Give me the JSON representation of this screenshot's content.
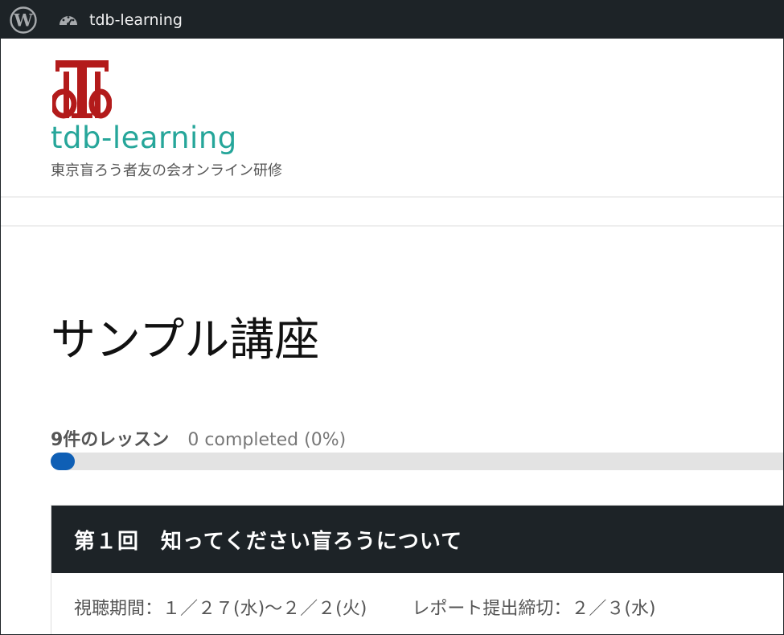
{
  "admin_bar": {
    "site_name": "tdb-learning",
    "icons": [
      "wordpress-logo-icon",
      "dashboard-gauge-icon"
    ],
    "background": "#1d2327"
  },
  "header": {
    "logo_icon": "tdb-monogram-logo",
    "logo_color": "#b31b1b",
    "site_title": "tdb-learning",
    "site_title_color": "#26a69a",
    "tagline": "東京盲ろう者友の会オンライン研修"
  },
  "course": {
    "title": "サンプル講座",
    "lesson_count": "9件のレッスン",
    "completed_text": "0 completed (0%)",
    "progress_percent": 0,
    "progress_color": "#0f5fb5",
    "lessons": [
      {
        "title": "第１回　知ってください盲ろうについて",
        "viewing_period": "視聴期間：１／２７(水)～２／２(火)",
        "report_deadline": "レポート提出締切：２／３(水)"
      }
    ]
  }
}
